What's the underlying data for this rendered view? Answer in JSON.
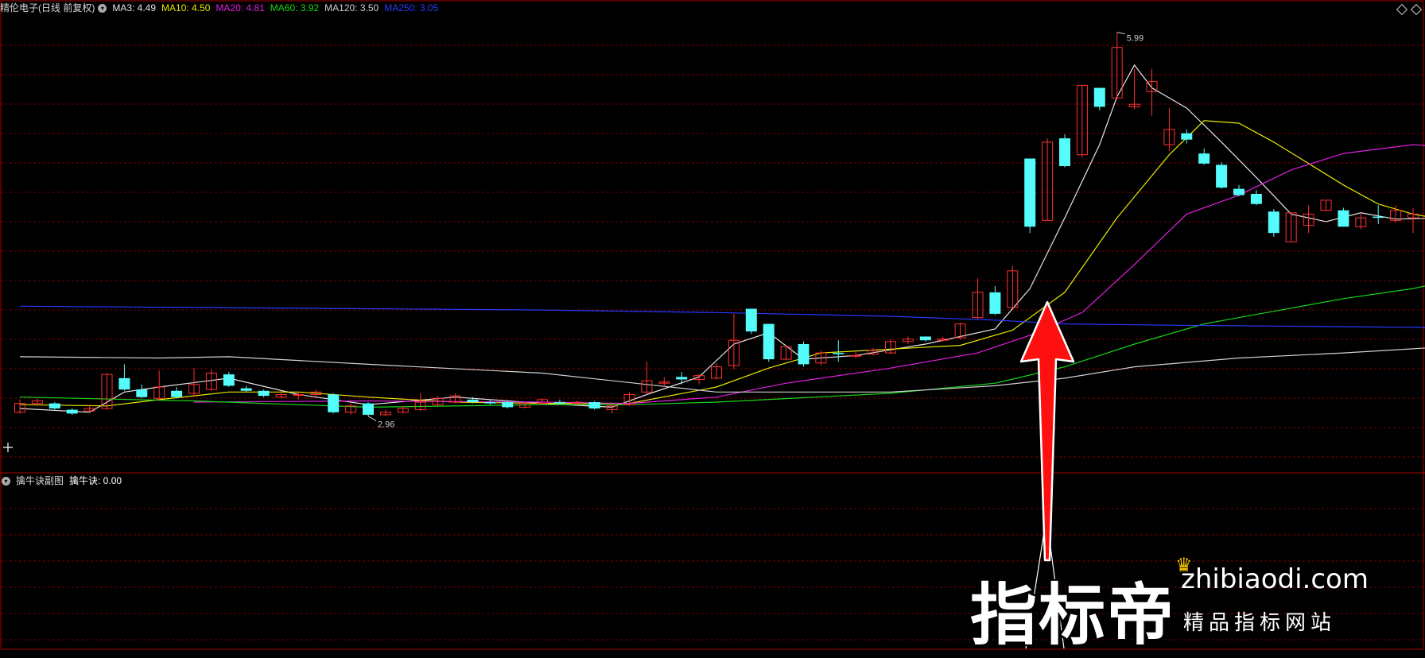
{
  "header": {
    "stock_name": "精伦电子(日线 前复权)",
    "ma": [
      {
        "label": "MA3: 4.49",
        "color": "#e6e6e6"
      },
      {
        "label": "MA10: 4.50",
        "color": "#e8e800"
      },
      {
        "label": "MA20: 4.81",
        "color": "#e020e0"
      },
      {
        "label": "MA60: 3.92",
        "color": "#18d818"
      },
      {
        "label": "MA120: 3.50",
        "color": "#d0d0d0"
      },
      {
        "label": "MA250: 3.05",
        "color": "#2a3aff"
      }
    ]
  },
  "sub_header": {
    "name": "擒牛诀副图",
    "value_label": "擒牛诀: 0.00"
  },
  "colors": {
    "up": "#ff3030",
    "down": "#54fcfc",
    "grid": "#7a0000",
    "frame": "#aa0000",
    "arrow": "#ff1010",
    "ma3": "#e6e6e6",
    "ma10": "#e8e800",
    "ma20": "#e020e0",
    "ma60": "#18d818",
    "ma120": "#d0d0d0",
    "ma250": "#2a3aff"
  },
  "chart_data": {
    "type": "candlestick",
    "price_range": [
      2.5,
      6.12
    ],
    "max_label": "5.99",
    "min_label": "2.96",
    "candles": [
      [
        2.98,
        3.05,
        2.97,
        3.08
      ],
      [
        3.05,
        3.07,
        3.03,
        3.09
      ],
      [
        3.05,
        3.01,
        3.0,
        3.06
      ],
      [
        3.0,
        2.97,
        2.96,
        3.01
      ],
      [
        2.99,
        3.01,
        2.98,
        3.04
      ],
      [
        3.01,
        3.28,
        3.0,
        3.29
      ],
      [
        3.25,
        3.16,
        3.15,
        3.36
      ],
      [
        3.16,
        3.1,
        3.09,
        3.2
      ],
      [
        3.09,
        3.18,
        3.07,
        3.31
      ],
      [
        3.15,
        3.1,
        3.09,
        3.18
      ],
      [
        3.13,
        3.2,
        3.1,
        3.33
      ],
      [
        3.16,
        3.29,
        3.15,
        3.32
      ],
      [
        3.28,
        3.19,
        3.18,
        3.3
      ],
      [
        3.17,
        3.15,
        3.14,
        3.19
      ],
      [
        3.15,
        3.11,
        3.1,
        3.16
      ],
      [
        3.1,
        3.12,
        3.09,
        3.15
      ],
      [
        3.12,
        3.12,
        3.08,
        3.14
      ],
      [
        3.12,
        3.14,
        3.1,
        3.16
      ],
      [
        3.12,
        2.98,
        2.97,
        3.13
      ],
      [
        2.98,
        3.03,
        2.96,
        3.05
      ],
      [
        3.05,
        2.96,
        2.95,
        3.06
      ],
      [
        2.96,
        2.98,
        2.95,
        3.0
      ],
      [
        2.98,
        3.01,
        2.97,
        3.03
      ],
      [
        3.0,
        3.06,
        2.99,
        3.13
      ],
      [
        3.04,
        3.09,
        3.03,
        3.11
      ],
      [
        3.06,
        3.11,
        3.05,
        3.13
      ],
      [
        3.08,
        3.06,
        3.05,
        3.1
      ],
      [
        3.06,
        3.05,
        3.04,
        3.08
      ],
      [
        3.06,
        3.02,
        3.01,
        3.07
      ],
      [
        3.02,
        3.05,
        3.01,
        3.06
      ],
      [
        3.05,
        3.08,
        3.04,
        3.09
      ],
      [
        3.06,
        3.05,
        3.04,
        3.08
      ],
      [
        3.05,
        3.06,
        3.04,
        3.07
      ],
      [
        3.06,
        3.01,
        3.0,
        3.07
      ],
      [
        3.0,
        3.03,
        2.97,
        3.04
      ],
      [
        3.04,
        3.12,
        3.03,
        3.14
      ],
      [
        3.14,
        3.23,
        3.12,
        3.38
      ],
      [
        3.21,
        3.22,
        3.18,
        3.26
      ],
      [
        3.26,
        3.24,
        3.2,
        3.3
      ],
      [
        3.24,
        3.27,
        3.2,
        3.28
      ],
      [
        3.25,
        3.34,
        3.24,
        3.37
      ],
      [
        3.35,
        3.55,
        3.32,
        3.76
      ],
      [
        3.8,
        3.62,
        3.6,
        3.8
      ],
      [
        3.68,
        3.4,
        3.38,
        3.68
      ],
      [
        3.4,
        3.5,
        3.39,
        3.51
      ],
      [
        3.52,
        3.36,
        3.34,
        3.54
      ],
      [
        3.37,
        3.45,
        3.35,
        3.47
      ],
      [
        3.45,
        3.44,
        3.38,
        3.55
      ],
      [
        3.43,
        3.43,
        3.41,
        3.46
      ],
      [
        3.44,
        3.47,
        3.43,
        3.49
      ],
      [
        3.45,
        3.54,
        3.44,
        3.56
      ],
      [
        3.54,
        3.56,
        3.52,
        3.58
      ],
      [
        3.58,
        3.55,
        3.54,
        3.58
      ],
      [
        3.55,
        3.56,
        3.54,
        3.58
      ],
      [
        3.57,
        3.68,
        3.56,
        3.69
      ],
      [
        3.73,
        3.93,
        3.72,
        4.04
      ],
      [
        3.93,
        3.76,
        3.75,
        3.98
      ],
      [
        3.81,
        4.1,
        3.81,
        4.14
      ],
      [
        4.99,
        4.45,
        4.4,
        4.99
      ],
      [
        4.5,
        5.12,
        4.5,
        5.15
      ],
      [
        5.15,
        4.93,
        4.92,
        5.18
      ],
      [
        5.02,
        5.57,
        5.0,
        5.57
      ],
      [
        5.55,
        5.4,
        5.37,
        5.55
      ],
      [
        5.47,
        5.87,
        5.46,
        5.99
      ],
      [
        5.4,
        5.42,
        5.38,
        5.7
      ],
      [
        5.52,
        5.6,
        5.33,
        5.7
      ],
      [
        5.1,
        5.22,
        5.05,
        5.39
      ],
      [
        5.19,
        5.14,
        5.11,
        5.22
      ],
      [
        5.03,
        4.95,
        4.94,
        5.07
      ],
      [
        4.94,
        4.76,
        4.75,
        4.96
      ],
      [
        4.75,
        4.7,
        4.69,
        4.78
      ],
      [
        4.71,
        4.63,
        4.62,
        4.74
      ],
      [
        4.57,
        4.4,
        4.37,
        4.59
      ],
      [
        4.33,
        4.56,
        4.33,
        4.56
      ],
      [
        4.46,
        4.55,
        4.4,
        4.62
      ],
      [
        4.58,
        4.66,
        4.58,
        4.66
      ],
      [
        4.58,
        4.45,
        4.45,
        4.6
      ],
      [
        4.45,
        4.52,
        4.43,
        4.56
      ],
      [
        4.53,
        4.52,
        4.47,
        4.62
      ],
      [
        4.5,
        4.58,
        4.48,
        4.62
      ],
      [
        4.52,
        4.55,
        4.4,
        4.6
      ],
      [
        4.58,
        4.57,
        4.55,
        4.65
      ]
    ],
    "ma_lines": [
      {
        "key": "ma3",
        "points": [
          [
            0,
            3.01
          ],
          [
            4,
            2.98
          ],
          [
            6,
            3.14
          ],
          [
            8,
            3.18
          ],
          [
            12,
            3.25
          ],
          [
            16,
            3.12
          ],
          [
            20,
            3.04
          ],
          [
            25,
            3.1
          ],
          [
            30,
            3.05
          ],
          [
            34,
            3.02
          ],
          [
            36,
            3.12
          ],
          [
            39,
            3.26
          ],
          [
            41,
            3.52
          ],
          [
            43,
            3.61
          ],
          [
            45,
            3.4
          ],
          [
            48,
            3.43
          ],
          [
            52,
            3.52
          ],
          [
            56,
            3.64
          ],
          [
            58,
            3.96
          ],
          [
            60,
            4.52
          ],
          [
            62,
            5.1
          ],
          [
            63,
            5.48
          ],
          [
            64,
            5.73
          ],
          [
            65,
            5.55
          ],
          [
            67,
            5.39
          ],
          [
            69,
            5.12
          ],
          [
            71,
            4.84
          ],
          [
            73,
            4.55
          ],
          [
            75,
            4.49
          ],
          [
            77,
            4.56
          ],
          [
            79,
            4.51
          ],
          [
            82,
            4.52
          ]
        ]
      },
      {
        "key": "ma10",
        "points": [
          [
            0,
            3.04
          ],
          [
            5,
            3.03
          ],
          [
            8,
            3.08
          ],
          [
            12,
            3.14
          ],
          [
            16,
            3.14
          ],
          [
            20,
            3.1
          ],
          [
            25,
            3.06
          ],
          [
            30,
            3.05
          ],
          [
            35,
            3.05
          ],
          [
            40,
            3.18
          ],
          [
            43,
            3.33
          ],
          [
            46,
            3.45
          ],
          [
            50,
            3.48
          ],
          [
            54,
            3.51
          ],
          [
            57,
            3.63
          ],
          [
            60,
            3.93
          ],
          [
            63,
            4.52
          ],
          [
            66,
            5.02
          ],
          [
            68,
            5.29
          ],
          [
            70,
            5.27
          ],
          [
            72,
            5.12
          ],
          [
            74,
            4.95
          ],
          [
            76,
            4.78
          ],
          [
            78,
            4.63
          ],
          [
            80,
            4.55
          ],
          [
            82,
            4.5
          ]
        ]
      },
      {
        "key": "ma20",
        "points": [
          [
            10,
            3.06
          ],
          [
            20,
            3.07
          ],
          [
            30,
            3.06
          ],
          [
            35,
            3.05
          ],
          [
            40,
            3.1
          ],
          [
            44,
            3.21
          ],
          [
            50,
            3.33
          ],
          [
            55,
            3.45
          ],
          [
            58,
            3.59
          ],
          [
            61,
            3.77
          ],
          [
            64,
            4.15
          ],
          [
            67,
            4.55
          ],
          [
            70,
            4.7
          ],
          [
            73,
            4.9
          ],
          [
            76,
            5.03
          ],
          [
            80,
            5.1
          ],
          [
            82,
            5.08
          ]
        ]
      },
      {
        "key": "ma60",
        "points": [
          [
            0,
            3.1
          ],
          [
            10,
            3.07
          ],
          [
            20,
            3.02
          ],
          [
            30,
            3.04
          ],
          [
            35,
            3.04
          ],
          [
            40,
            3.06
          ],
          [
            50,
            3.13
          ],
          [
            56,
            3.21
          ],
          [
            60,
            3.34
          ],
          [
            64,
            3.52
          ],
          [
            68,
            3.68
          ],
          [
            72,
            3.78
          ],
          [
            76,
            3.88
          ],
          [
            80,
            3.96
          ],
          [
            82,
            4.02
          ]
        ]
      },
      {
        "key": "ma120",
        "points": [
          [
            0,
            3.42
          ],
          [
            8,
            3.41
          ],
          [
            12,
            3.42
          ],
          [
            20,
            3.36
          ],
          [
            30,
            3.29
          ],
          [
            36,
            3.2
          ],
          [
            40,
            3.14
          ],
          [
            50,
            3.14
          ],
          [
            56,
            3.19
          ],
          [
            60,
            3.25
          ],
          [
            64,
            3.34
          ],
          [
            70,
            3.41
          ],
          [
            76,
            3.45
          ],
          [
            82,
            3.5
          ]
        ]
      },
      {
        "key": "ma250",
        "points": [
          [
            0,
            3.82
          ],
          [
            10,
            3.81
          ],
          [
            20,
            3.8
          ],
          [
            30,
            3.79
          ],
          [
            40,
            3.77
          ],
          [
            50,
            3.74
          ],
          [
            56,
            3.71
          ],
          [
            60,
            3.68
          ],
          [
            66,
            3.67
          ],
          [
            74,
            3.66
          ],
          [
            82,
            3.65
          ]
        ]
      }
    ]
  },
  "watermark": {
    "big": "指标帝",
    "site": "zhibiaodi.com",
    "sub": "精品指标网站"
  }
}
